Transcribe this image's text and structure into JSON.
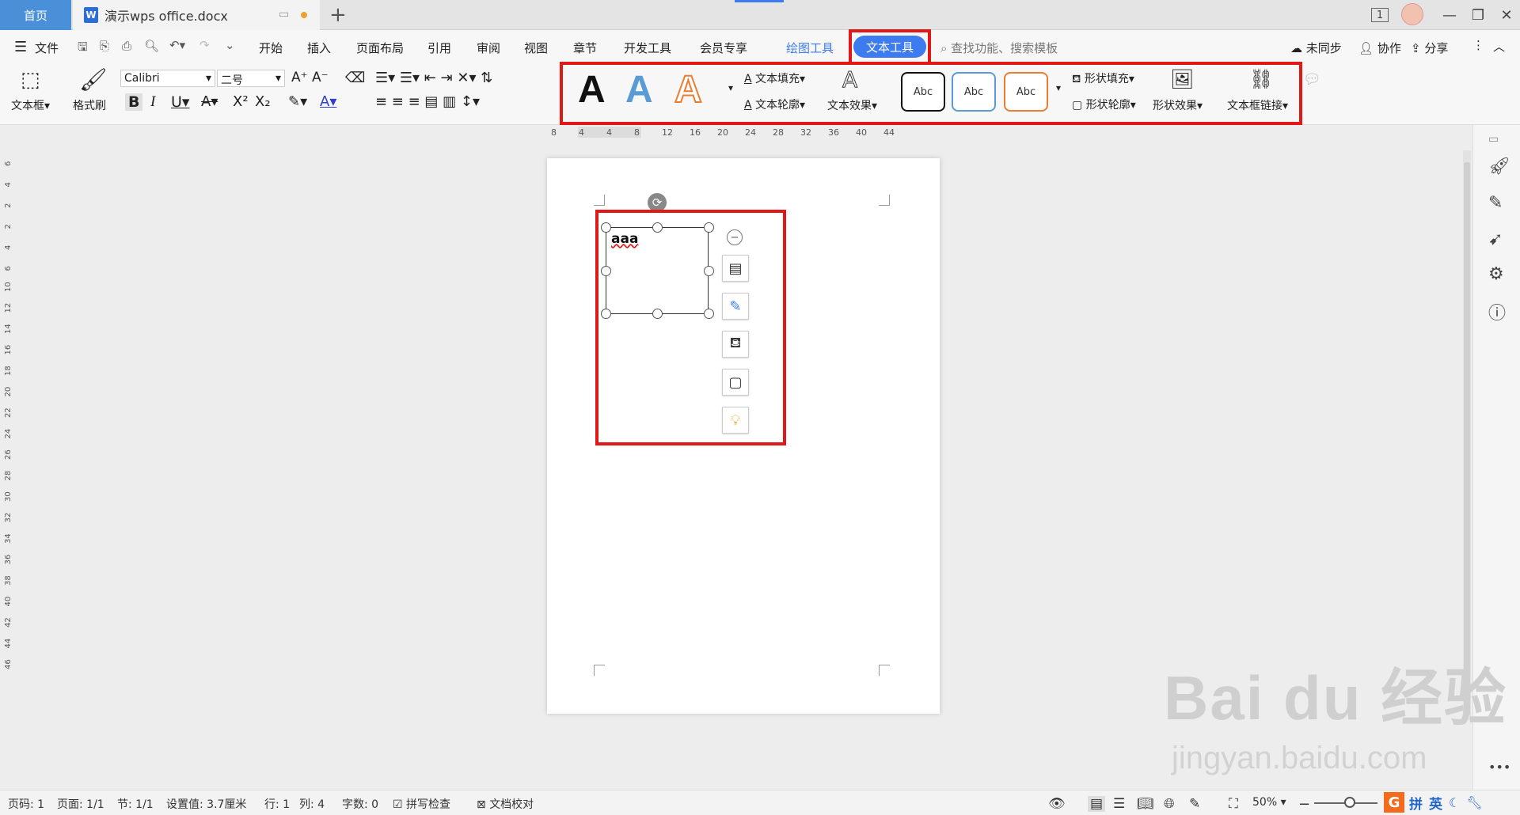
{
  "titlebar": {
    "home_tab": "首页",
    "doc_tab": "演示wps office.docx",
    "doc_icon": "W",
    "new_tab": "+",
    "page_indicator": "1"
  },
  "menubar": {
    "file_label": "文件",
    "tabs": [
      "开始",
      "插入",
      "页面布局",
      "引用",
      "审阅",
      "视图",
      "章节",
      "开发工具",
      "会员专享"
    ],
    "drawing_tools": "绘图工具",
    "text_tools": "文本工具",
    "search_placeholder": "查找功能、搜索模板",
    "sync": "未同步",
    "collab": "协作",
    "share": "分享"
  },
  "ribbon": {
    "textbox_label": "文本框",
    "format_painter": "格式刷",
    "font_name": "Calibri",
    "font_size": "二号",
    "big_letter": "A",
    "text_fill": "文本填充",
    "text_outline": "文本轮廓",
    "text_effect": "文本效果",
    "shape_preview": "Abc",
    "shape_fill": "形状填充",
    "shape_outline": "形状轮廓",
    "shape_effect": "形状效果",
    "textbox_link": "文本框链接"
  },
  "ruler_h": [
    "8",
    "4",
    "4",
    "8",
    "12",
    "16",
    "20",
    "24",
    "28",
    "32",
    "36",
    "40",
    "44"
  ],
  "ruler_v": [
    "6",
    "4",
    "2",
    "2",
    "4",
    "6",
    "10",
    "12",
    "14",
    "16",
    "18",
    "20",
    "22",
    "24",
    "26",
    "28",
    "30",
    "32",
    "34",
    "36",
    "38",
    "40",
    "42",
    "44",
    "46"
  ],
  "document": {
    "textbox_text": "aaa"
  },
  "statusbar": {
    "page": "页码: 1",
    "pages": "页面: 1/1",
    "section": "节: 1/1",
    "setting": "设置值: 3.7厘米",
    "row": "行: 1",
    "col": "列: 4",
    "words": "字数: 0",
    "spell": "拼写检查",
    "proof": "文档校对",
    "zoom": "50%"
  },
  "pinyin_bar": {
    "logo": "G",
    "labels": [
      "拼",
      "英"
    ]
  },
  "watermark": {
    "main": "Bai du 经验",
    "sub": "jingyan.baidu.com"
  },
  "colors": {
    "accent": "#3d7cf0",
    "highlight_red": "#e01818",
    "wordart_blue": "#5b9bd5",
    "wordart_orange": "#ed7d31"
  }
}
